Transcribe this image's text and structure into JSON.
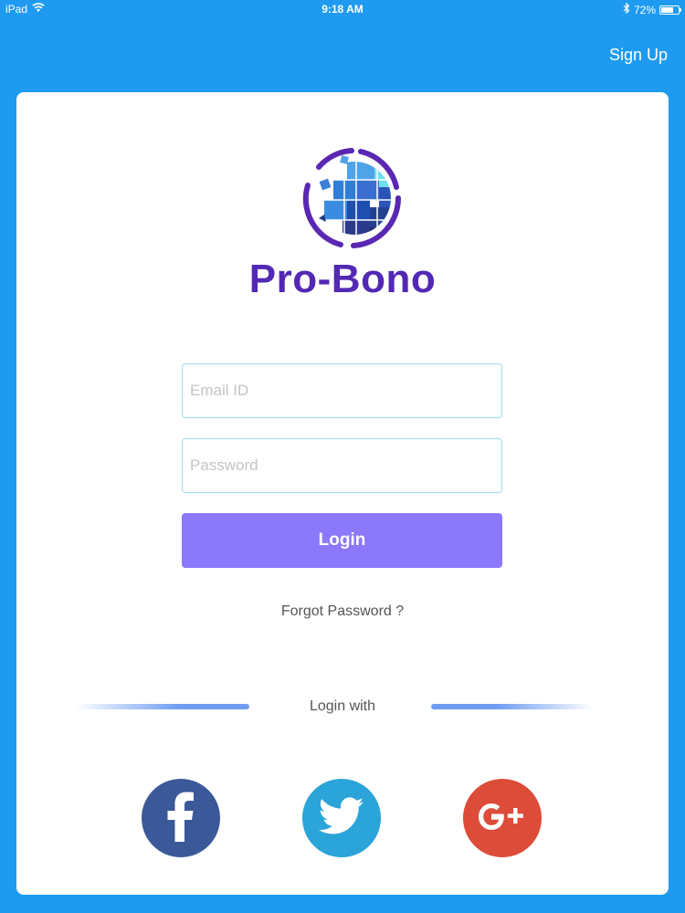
{
  "status_bar": {
    "device": "iPad",
    "time": "9:18 AM",
    "battery": "72%",
    "battery_level": 0.72,
    "icons": [
      "wifi-icon",
      "bluetooth-icon",
      "battery-icon"
    ]
  },
  "header": {
    "signup_label": "Sign Up"
  },
  "brand": {
    "name": "Pro-Bono",
    "color": "#5228b4"
  },
  "form": {
    "email": {
      "placeholder": "Email ID",
      "value": ""
    },
    "password": {
      "placeholder": "Password",
      "value": ""
    },
    "login_label": "Login",
    "forgot_label": "Forgot Password ?"
  },
  "social": {
    "label": "Login with",
    "buttons": [
      {
        "icon": "facebook-icon",
        "color": "#3b5998"
      },
      {
        "icon": "twitter-icon",
        "color": "#2aa4d9"
      },
      {
        "icon": "google-plus-icon",
        "color": "#dd4b39"
      }
    ]
  },
  "colors": {
    "background": "#1e9bf0",
    "accent": "#8b78fb",
    "field_border": "#9edcef"
  }
}
